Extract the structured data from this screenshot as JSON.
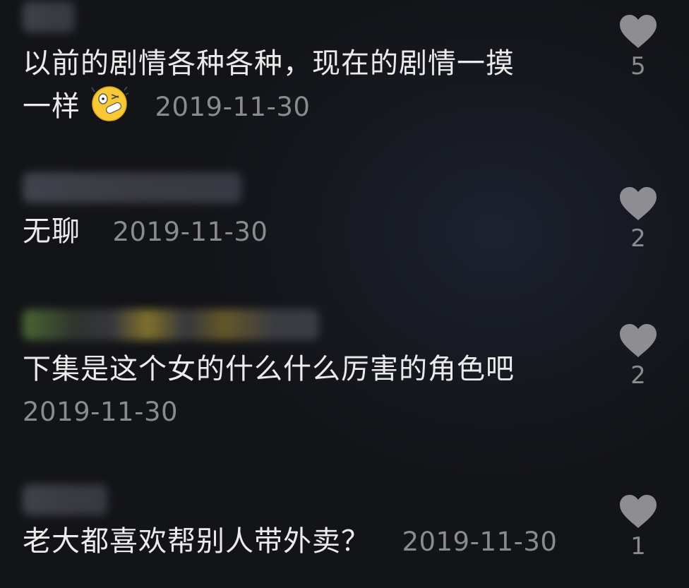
{
  "comments": [
    {
      "text_line1": "以前的剧情各种各种，现在的剧情一摸",
      "text_line2": "一样",
      "emoji": "shocked-emoji",
      "date": "2019-11-30",
      "likes": "5"
    },
    {
      "text": "无聊",
      "date": "2019-11-30",
      "likes": "2"
    },
    {
      "text": "下集是这个女的什么什么厉害的角色吧",
      "date": "2019-11-30",
      "likes": "2"
    },
    {
      "text": "老大都喜欢帮别人带外卖？",
      "date": "2019-11-30",
      "likes": "1"
    }
  ],
  "icons": {
    "like": "heart-icon"
  },
  "colors": {
    "background": "#141519",
    "text": "#ebebeb",
    "meta": "#8a8b8f",
    "heart": "#8e8e92"
  }
}
